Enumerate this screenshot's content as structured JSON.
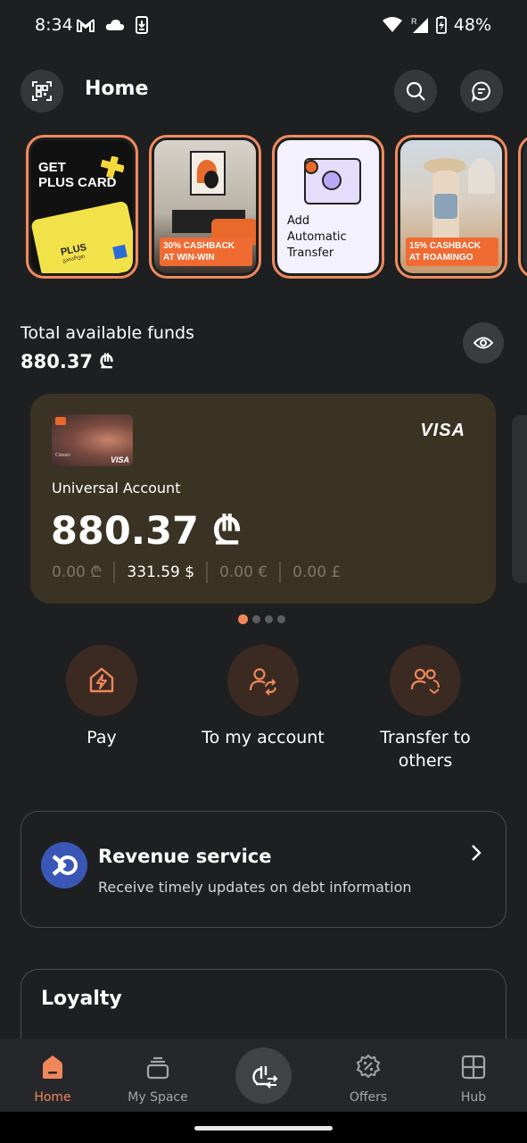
{
  "status_bar": {
    "time": "8:34",
    "battery": "48%",
    "icons": [
      "gmail-icon",
      "cloud-icon",
      "download-icon",
      "wifi-icon",
      "signal-roaming-icon",
      "battery-charging-icon"
    ]
  },
  "header": {
    "title": "Home",
    "left_icon": "qr-scan-icon",
    "right_icons": [
      "search-icon",
      "chat-icon"
    ]
  },
  "stories": [
    {
      "name": "plus-card",
      "line1": "GET",
      "line2": "PLUS CARD",
      "card_text": "PLUS",
      "card_subtext": "გაიარეთ"
    },
    {
      "name": "win-win",
      "line1": "30% CASHBACK",
      "line2": "AT WIN-WIN"
    },
    {
      "name": "automatic-transfer",
      "line1": "Add",
      "line2": "Automatic",
      "line3": "Transfer"
    },
    {
      "name": "roamingo",
      "line1": "15% CASHBACK",
      "line2": "AT ROAMINGO"
    }
  ],
  "funds": {
    "label": "Total available funds",
    "amount": "880.37 ₾"
  },
  "account_card": {
    "name": "Universal Account",
    "balance": "880.37 ₾",
    "brand": "VISA",
    "thumb_label": "Classic",
    "thumb_brand": "VISA",
    "currencies": [
      {
        "value": "0.00 ₾",
        "active": false
      },
      {
        "value": "331.59 $",
        "active": true
      },
      {
        "value": "0.00 €",
        "active": false
      },
      {
        "value": "0.00 £",
        "active": false
      }
    ],
    "page_count": 4,
    "active_page": 1
  },
  "actions": [
    {
      "name": "pay",
      "label": "Pay",
      "icon": "house-lightning-icon"
    },
    {
      "name": "to-my-account",
      "label": "To my account",
      "icon": "user-transfer-icon"
    },
    {
      "name": "transfer-to-others",
      "label_line1": "Transfer to",
      "label_line2": "others",
      "icon": "users-transfer-icon"
    }
  ],
  "revenue_service": {
    "title": "Revenue service",
    "subtitle": "Receive timely updates on debt information"
  },
  "loyalty": {
    "title": "Loyalty"
  },
  "bottom_nav": [
    {
      "name": "home",
      "label": "Home",
      "active": true
    },
    {
      "name": "my-space",
      "label": "My Space",
      "active": false
    },
    {
      "name": "transfer",
      "label": "",
      "active": false
    },
    {
      "name": "offers",
      "label": "Offers",
      "active": false
    },
    {
      "name": "hub",
      "label": "Hub",
      "active": false
    }
  ],
  "colors": {
    "background": "#1e1f21",
    "accent": "#f0875a",
    "card": "#3a3223",
    "action_circle": "#3a2a22"
  }
}
